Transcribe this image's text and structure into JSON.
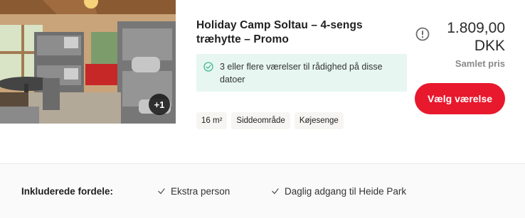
{
  "room": {
    "title": "Holiday Camp Soltau – 4-sengs træhytte – Promo",
    "photo_more": "+1",
    "availability": "3 eller flere værelser til rådighed på disse datoer",
    "tags": [
      "16 m²",
      "Siddeområde",
      "Køjesenge"
    ],
    "price": "1.809,00 DKK",
    "price_label": "Samlet pris",
    "choose_button": "Vælg værelse",
    "info_icon": "info-circle-icon",
    "check_icon": "check-circle-icon"
  },
  "benefits": {
    "label": "Inkluderede fordele:",
    "items": [
      "Ekstra person",
      "Daglig adgang til Heide Park"
    ]
  },
  "colors": {
    "accent": "#e8182d",
    "availability_bg": "#e7f6f1",
    "availability_icon": "#3cb98a"
  }
}
